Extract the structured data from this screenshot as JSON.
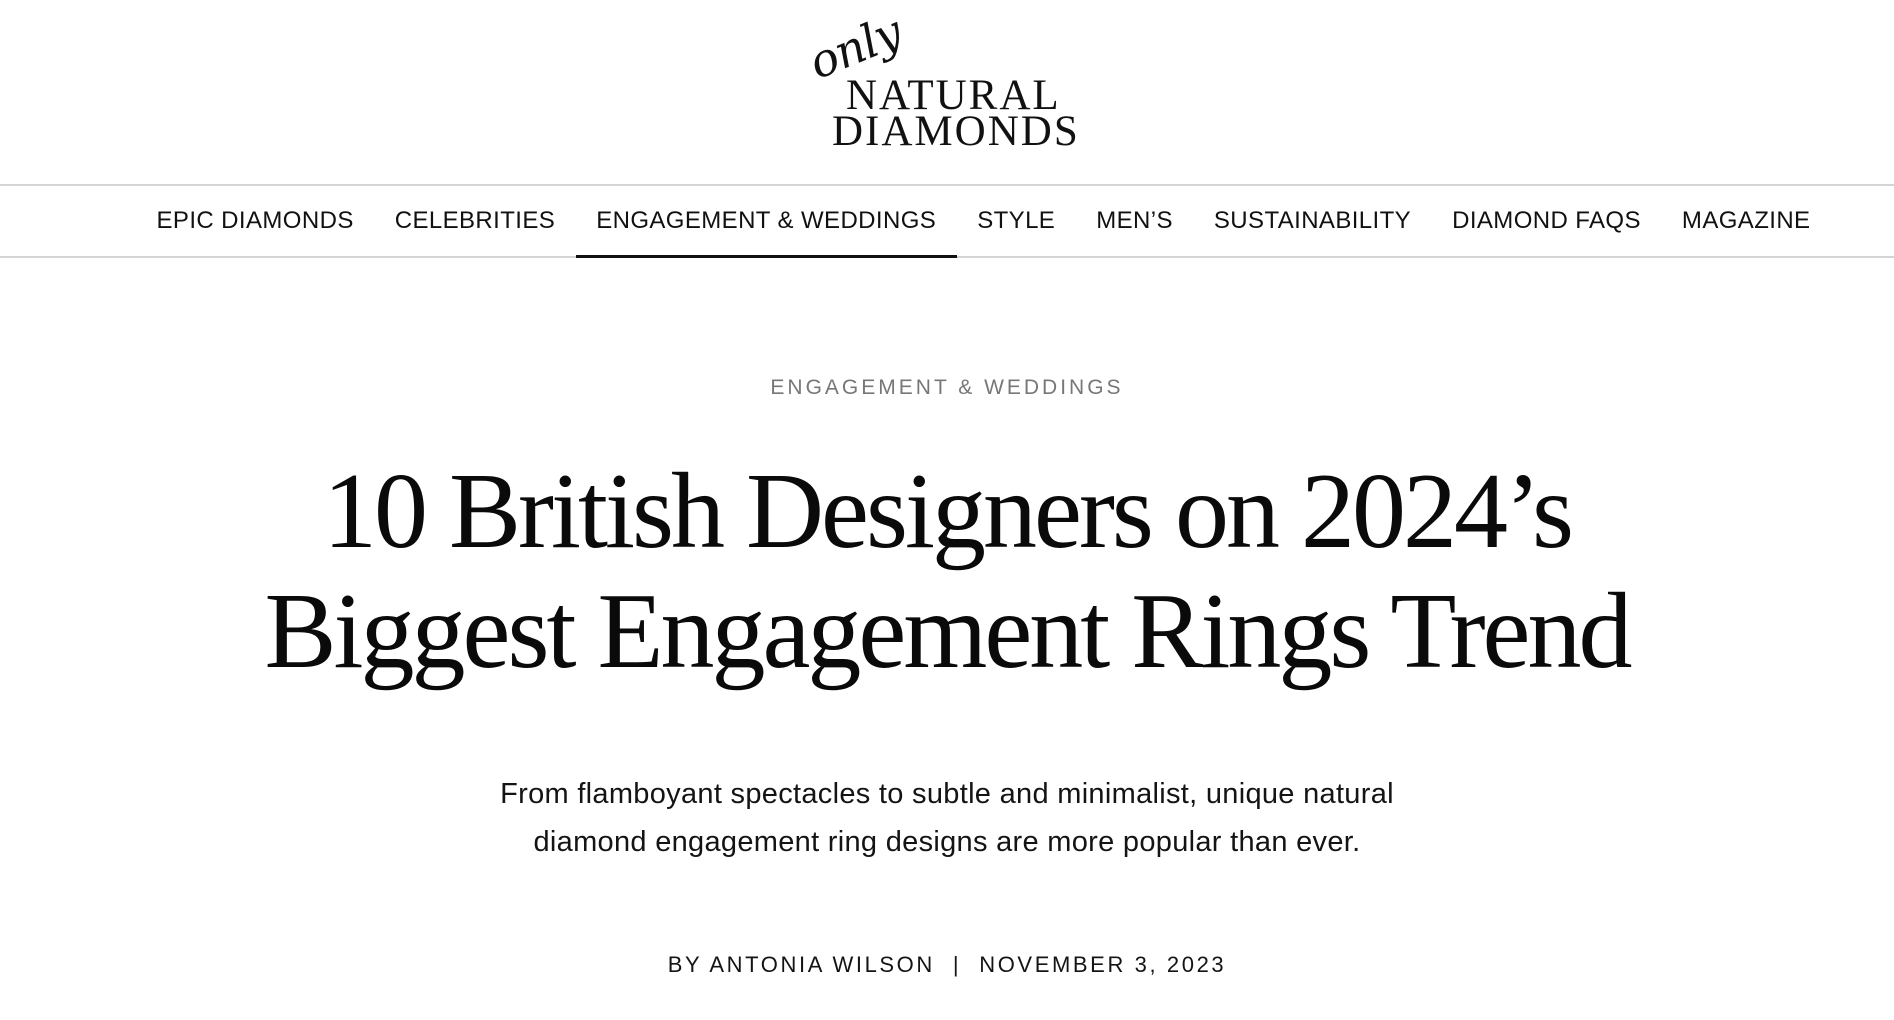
{
  "logo": {
    "script_text": "only",
    "line1": "NATURAL",
    "line2": "DIAMONDS"
  },
  "nav": {
    "items": [
      {
        "label": "EPIC DIAMONDS"
      },
      {
        "label": "CELEBRITIES"
      },
      {
        "label": "ENGAGEMENT & WEDDINGS",
        "active": true
      },
      {
        "label": "STYLE"
      },
      {
        "label": "MEN’S"
      },
      {
        "label": "SUSTAINABILITY"
      },
      {
        "label": "DIAMOND FAQS"
      },
      {
        "label": "MAGAZINE"
      }
    ]
  },
  "article": {
    "category": "ENGAGEMENT & WEDDINGS",
    "headline_line1": "10 British Designers on 2024’s",
    "headline_line2": "Biggest Engagement Rings Trend",
    "dek_line1": "From flamboyant spectacles to subtle and minimalist, unique natural",
    "dek_line2": "diamond engagement ring designs are more popular than ever.",
    "byline_prefix": "BY ",
    "author": "ANTONIA WILSON",
    "separator": "|",
    "date": "NOVEMBER 3, 2023"
  },
  "colors": {
    "text": "#0d0d0d",
    "muted": "#777777",
    "divider": "#d4d4d4",
    "active_underline": "#111111"
  }
}
